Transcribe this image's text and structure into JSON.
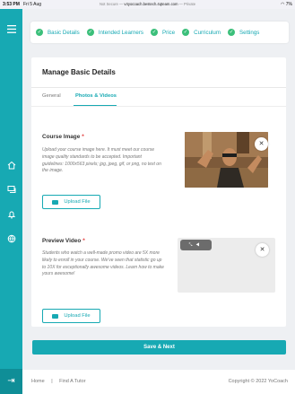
{
  "status_bar": {
    "time": "3:53 PM",
    "date": "Fri 5 Aug",
    "url_prefix": "Not Secure —",
    "url_host": "v4yocoach.bestech.4qteam.com",
    "url_suffix": "— Private",
    "battery": "7%"
  },
  "steps": [
    {
      "label": "Basic Details"
    },
    {
      "label": "Intended Learners"
    },
    {
      "label": "Price"
    },
    {
      "label": "Curriculum"
    },
    {
      "label": "Settings"
    }
  ],
  "card": {
    "title": "Manage Basic Details",
    "tabs": [
      {
        "label": "General"
      },
      {
        "label": "Photos & Videos"
      }
    ]
  },
  "course_image": {
    "title": "Course Image",
    "required_mark": "*",
    "description": "Upload your course image here. It must meet our course image quality standards to be accepted. Important guidelines: 1000x563 pixels; jpg, jpeg, gif, or png, no text on the image.",
    "upload_label": "Upload File"
  },
  "preview_video": {
    "title": "Preview Video",
    "required_mark": "*",
    "description": "Students who watch a well-made promo video are 5X more likely to enroll in your course. We've seen that statistic go up to 10X for exceptionally awesome videos. Learn how to make yours awesome!",
    "upload_label": "Upload File"
  },
  "save_button": "Save & Next",
  "footer": {
    "links": [
      "Home",
      "|",
      "Find A Tutor"
    ],
    "copyright": "Copyright © 2022 YoCoach"
  },
  "colors": {
    "accent": "#17a9b3",
    "check": "#3bbf7a",
    "required": "#e23838"
  }
}
